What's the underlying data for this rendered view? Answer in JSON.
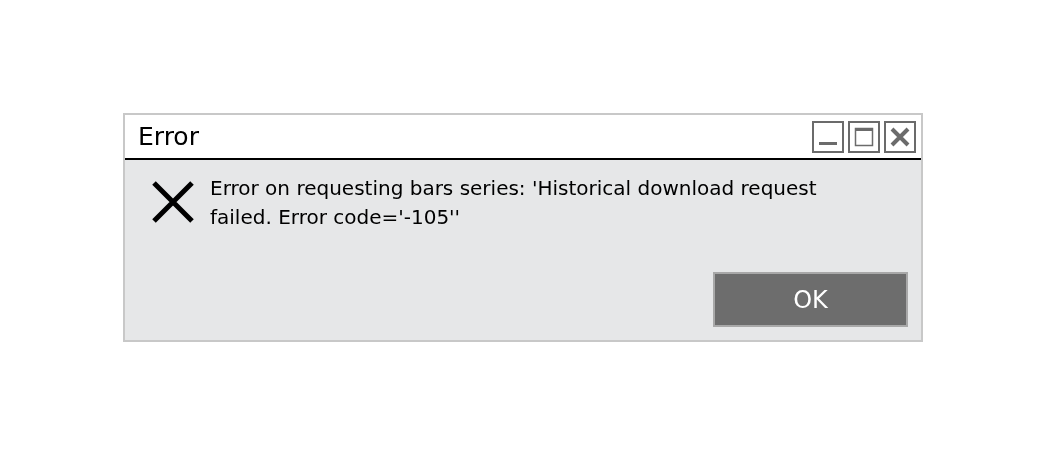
{
  "window": {
    "title": "Error"
  },
  "message": "Error on requesting bars series: 'Historical download request failed. Error code='-105''",
  "buttons": [
    "OK"
  ]
}
